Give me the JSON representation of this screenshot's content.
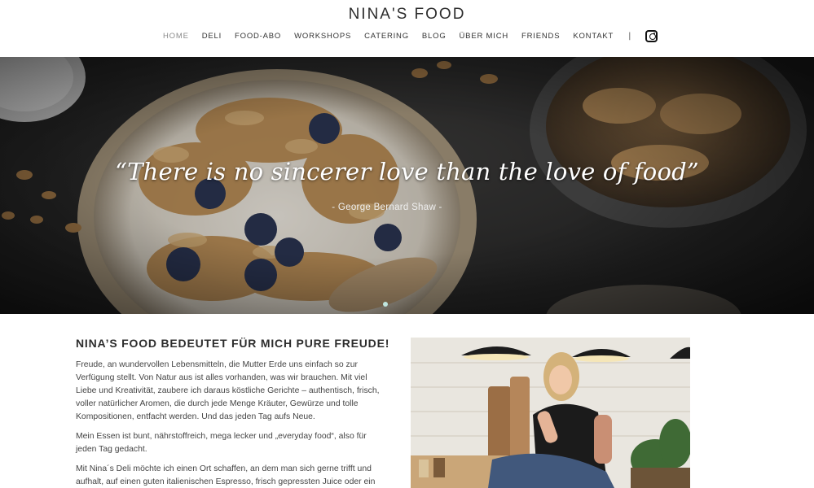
{
  "site": {
    "brand": "NINA'S FOOD"
  },
  "nav": {
    "items": [
      {
        "label": "HOME",
        "active": true
      },
      {
        "label": "DELI"
      },
      {
        "label": "FOOD-ABO"
      },
      {
        "label": "WORKSHOPS"
      },
      {
        "label": "CATERING"
      },
      {
        "label": "BLOG"
      },
      {
        "label": "ÜBER MICH"
      },
      {
        "label": "FRIENDS"
      },
      {
        "label": "KONTAKT"
      }
    ],
    "separator": "|",
    "instagram_icon": "instagram-icon"
  },
  "hero": {
    "quote": "“There is no sincerer love than the love of food”",
    "author": "- George Bernard Shaw -",
    "slide_count": 1,
    "active_slide": 1
  },
  "content": {
    "title": "NINA’S FOOD BEDEUTET FÜR MICH PURE FREUDE!",
    "paragraphs": [
      "Freude, an wundervollen Lebensmitteln, die Mutter Erde uns einfach so zur Verfügung stellt. Von Natur aus ist alles vorhanden, was wir brauchen. Mit viel Liebe und Kreativität, zaubere ich daraus köstliche Gerichte – authentisch, frisch, voller natürlicher Aromen, die durch jede Menge Kräuter, Gewürze und tolle Kompositionen, entfacht werden. Und das jeden Tag aufs Neue.",
      "Mein Essen ist bunt, nährstoffreich, mega lecker und „everyday food“, also für jeden Tag gedacht.",
      "Mit Nina´s Deli möchte ich einen Ort schaffen, an dem man sich gerne trifft und aufhalt, auf einen guten italienischen Espresso, frisch gepressten Juice oder ein"
    ]
  },
  "colors": {
    "text": "#333333",
    "nav_active": "#8a8a8a",
    "hero_bg": "#2a2a2a",
    "slider_dot_active": "#bfe6e0"
  }
}
